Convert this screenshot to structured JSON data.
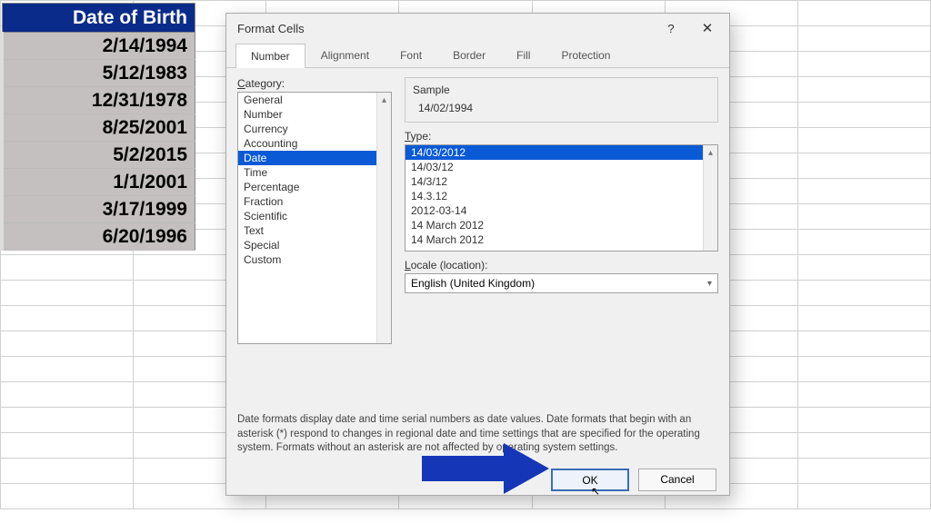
{
  "spreadsheet": {
    "header": "Date of Birth",
    "rows": [
      "2/14/1994",
      "5/12/1983",
      "12/31/1978",
      "8/25/2001",
      "5/2/2015",
      "1/1/2001",
      "3/17/1999",
      "6/20/1996"
    ]
  },
  "dialog": {
    "title": "Format Cells",
    "help": "?",
    "close": "✕",
    "tabs": [
      "Number",
      "Alignment",
      "Font",
      "Border",
      "Fill",
      "Protection"
    ],
    "active_tab": "Number",
    "category_label": "Category:",
    "categories": [
      "General",
      "Number",
      "Currency",
      "Accounting",
      "Date",
      "Time",
      "Percentage",
      "Fraction",
      "Scientific",
      "Text",
      "Special",
      "Custom"
    ],
    "category_selected": "Date",
    "sample_label": "Sample",
    "sample_value": "14/02/1994",
    "type_label": "Type:",
    "types": [
      "14/03/2012",
      "14/03/12",
      "14/3/12",
      "14.3.12",
      "2012-03-14",
      "14 March 2012",
      "14 March 2012"
    ],
    "type_selected": "14/03/2012",
    "locale_label": "Locale (location):",
    "locale_value": "English (United Kingdom)",
    "description": "Date formats display date and time serial numbers as date values.  Date formats that begin with an asterisk (*) respond to changes in regional date and time settings that are specified for the operating system.  Formats without an asterisk are not affected by operating system settings.",
    "ok": "OK",
    "cancel": "Cancel"
  }
}
